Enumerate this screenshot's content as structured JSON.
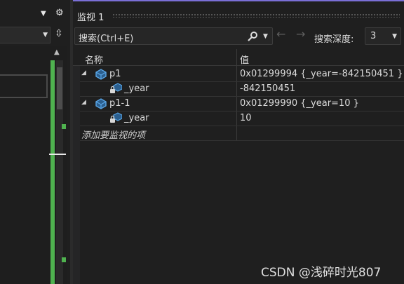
{
  "watch": {
    "title": "监视 1",
    "search_placeholder": "搜索(Ctrl+E)",
    "search_depth_label": "搜索深度:",
    "search_depth_value": "3",
    "columns": {
      "name": "名称",
      "value": "值"
    },
    "rows": [
      {
        "name": "p1",
        "value": "0x01299994 {_year=-842150451 }",
        "kind": "object",
        "expanded": true,
        "indent": 0
      },
      {
        "name": "_year",
        "value": "-842150451",
        "kind": "field",
        "indent": 1
      },
      {
        "name": "p1-1",
        "value": "0x01299990 {_year=10 }",
        "kind": "object",
        "expanded": true,
        "indent": 0
      },
      {
        "name": "_year",
        "value": "10",
        "kind": "field",
        "indent": 1
      },
      {
        "name": "添加要监视的项",
        "value": "",
        "kind": "add",
        "indent": 0
      }
    ]
  },
  "watermark": "CSDN @浅碎时光807",
  "colors": {
    "accent": "#7a6fd6",
    "scroll_marker_green": "#4fb24f",
    "icon_blue": "#5aa6e6"
  }
}
